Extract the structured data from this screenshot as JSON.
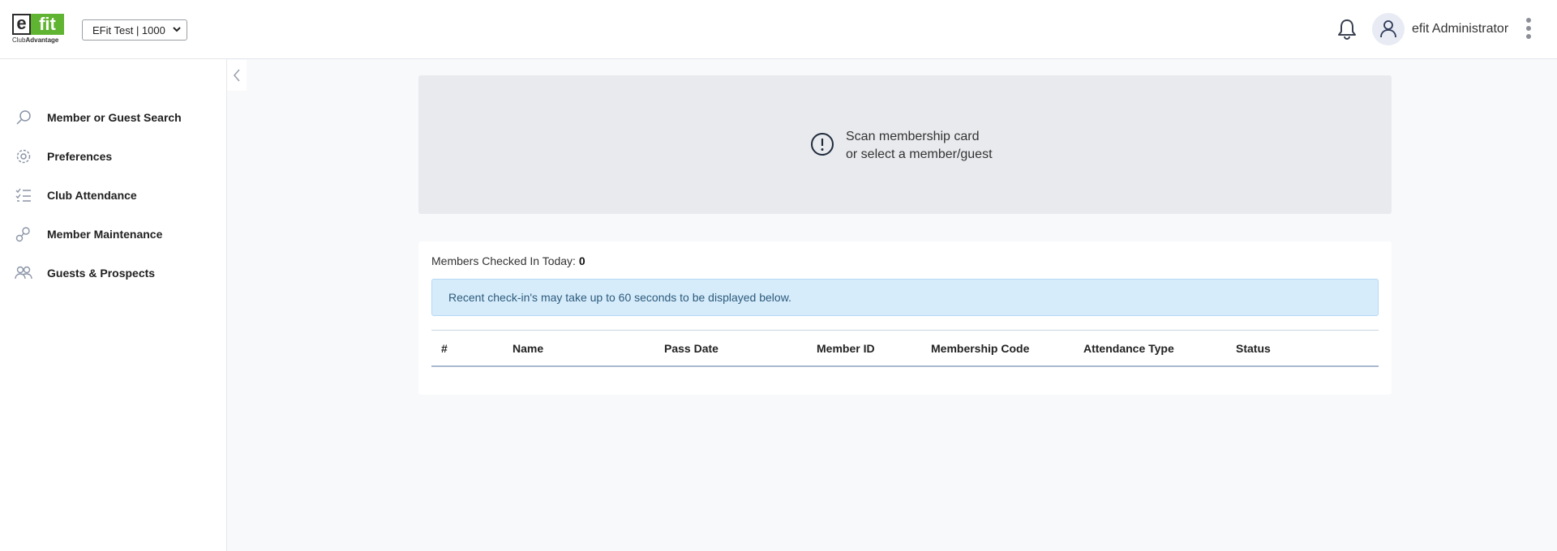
{
  "header": {
    "logo_text_e": "e",
    "logo_text_fit": "fit",
    "logo_tagline_club": "Club",
    "logo_tagline_advantage": "Advantage",
    "club_select_value": "EFit Test | 1000",
    "user_name": "efit Administrator"
  },
  "sidebar": {
    "items": [
      {
        "label": "Member or Guest Search",
        "icon": "search-icon"
      },
      {
        "label": "Preferences",
        "icon": "gear-icon"
      },
      {
        "label": "Club Attendance",
        "icon": "checklist-icon"
      },
      {
        "label": "Member Maintenance",
        "icon": "user-cog-icon"
      },
      {
        "label": "Guests & Prospects",
        "icon": "users-icon"
      }
    ]
  },
  "scan_panel": {
    "line1": "Scan membership card",
    "line2": "or select a member/guest"
  },
  "checkins": {
    "count_label": "Members Checked In Today:",
    "count_value": "0",
    "notice": "Recent check-in's may take up to 60 seconds to be displayed below.",
    "columns": [
      "#",
      "Name",
      "Pass Date",
      "Member ID",
      "Membership Code",
      "Attendance Type",
      "Status"
    ]
  },
  "colors": {
    "brand_green": "#5fb431",
    "alert_bg": "#d6ecfb",
    "scan_bg": "#e8eaed"
  }
}
